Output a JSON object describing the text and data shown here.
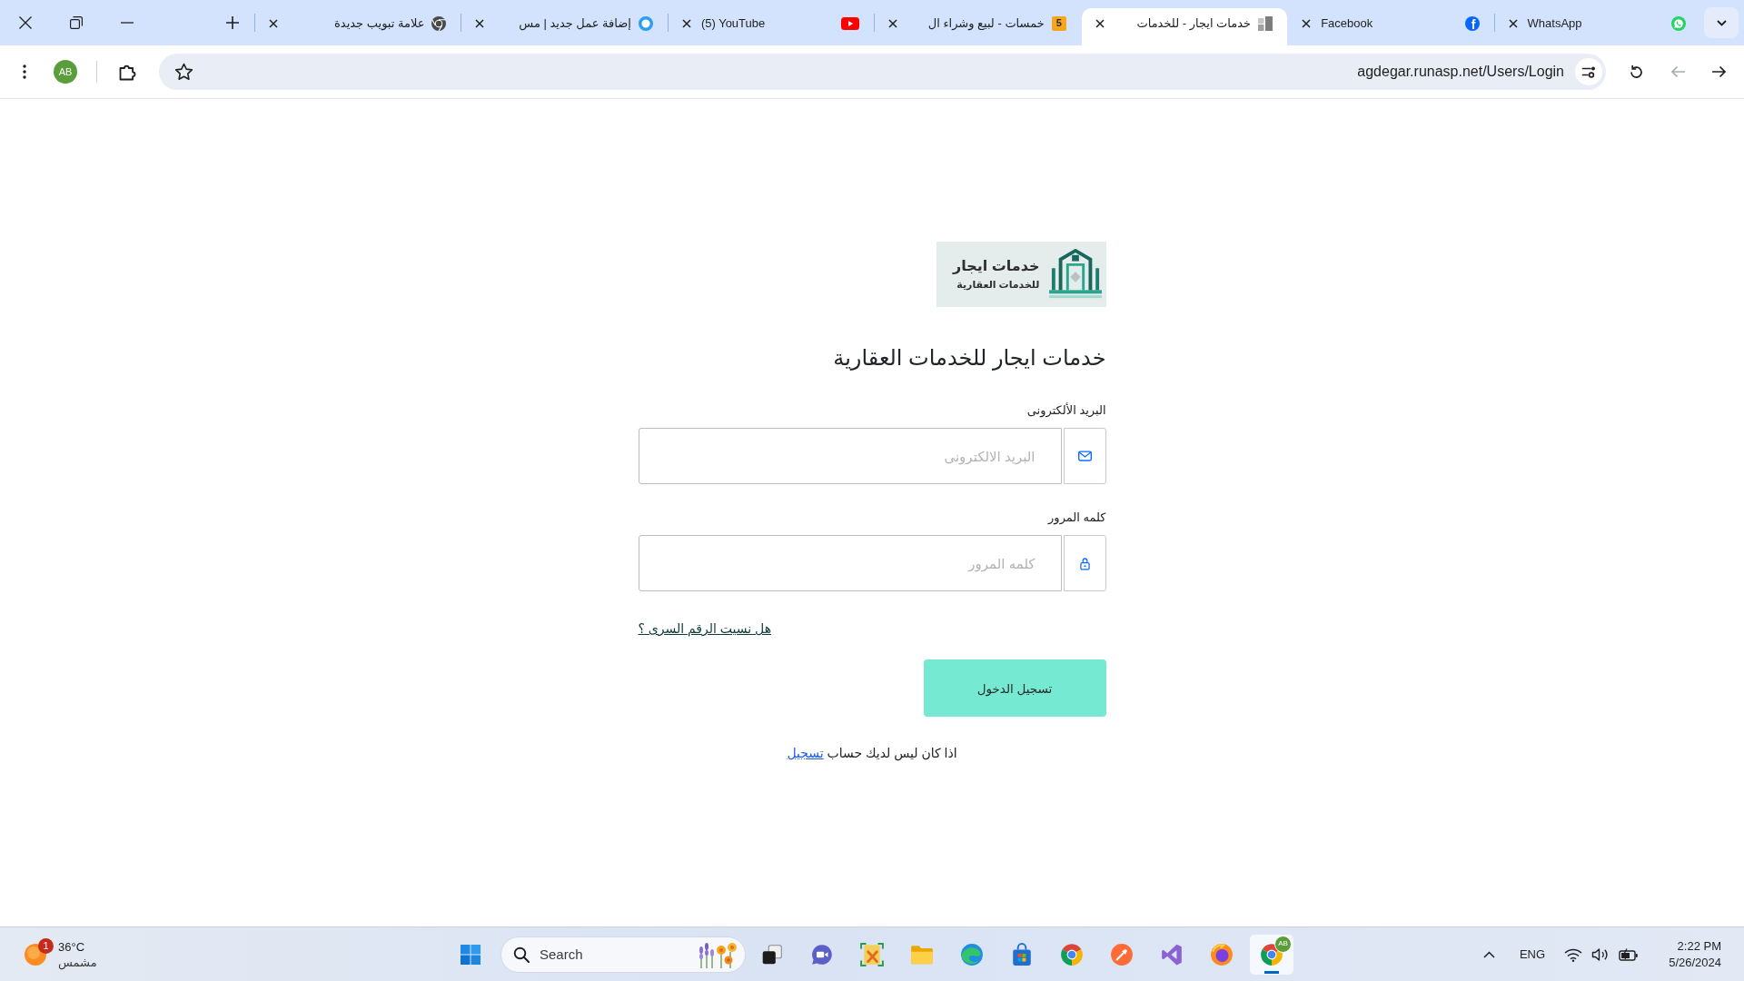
{
  "tabs": [
    {
      "title": "WhatsApp",
      "kind": "chat",
      "selected": false
    },
    {
      "title": "Facebook",
      "kind": "disc",
      "favicon_text": "f",
      "selected": false
    },
    {
      "title": "خدمات ايجار - للخدمات",
      "kind": "blocks",
      "selected": true
    },
    {
      "title": "خمسات - لبيع وشراء ال",
      "kind": "tile",
      "favicon_text": "5",
      "selected": false
    },
    {
      "title": "(5) YouTube",
      "kind": "play",
      "selected": false
    },
    {
      "title": "إضافة عمل جديد | مس",
      "kind": "ring",
      "selected": false
    },
    {
      "title": "علامة تبويب جديدة",
      "kind": "aperture",
      "selected": false
    }
  ],
  "toolbar": {
    "nav_buttons": [
      {
        "kind": "back",
        "disabled": false
      },
      {
        "kind": "forward",
        "disabled": true
      }
    ],
    "url": "agdegar.runasp.net/Users/Login",
    "profile_initials": "AB"
  },
  "page": {
    "logo": {
      "title": "خدمات ايجار",
      "subtitle": "للخدمات العقارية"
    },
    "title": "خدمات ايجار للخدمات العقارية",
    "fields": [
      {
        "kind": "email",
        "label": "البريد الألكترونى",
        "placeholder": "البريد الالكترونى"
      },
      {
        "kind": "password",
        "label": "كلمه المرور",
        "placeholder": "كلمه المرور"
      }
    ],
    "forgot_link": "هل نسيت الرقم السرى ؟",
    "submit_button": "تسجيل الدخول",
    "signup_prompt": {
      "text": "اذا كان ليس لديك حساب",
      "link": "تسجيل"
    }
  },
  "taskbar": {
    "weather": {
      "temperature": "36°C",
      "condition": "مشمس",
      "badge": "1"
    },
    "search": {
      "label": "Search"
    },
    "apps": [
      {
        "kind": "squares",
        "selected": false
      },
      {
        "kind": "videochat",
        "selected": false
      },
      {
        "kind": "tools",
        "selected": false
      },
      {
        "kind": "folder",
        "selected": false
      },
      {
        "kind": "wave",
        "selected": false
      },
      {
        "kind": "bag",
        "selected": false
      },
      {
        "kind": "tricolor",
        "selected": false
      },
      {
        "kind": "rocket",
        "selected": false
      },
      {
        "kind": "ribbon",
        "selected": false
      },
      {
        "kind": "flame",
        "selected": false
      },
      {
        "kind": "tricolor",
        "selected": true,
        "badge": "AB"
      }
    ],
    "tray": {
      "language": "ENG",
      "time": "2:22 PM",
      "date": "5/26/2024"
    }
  }
}
